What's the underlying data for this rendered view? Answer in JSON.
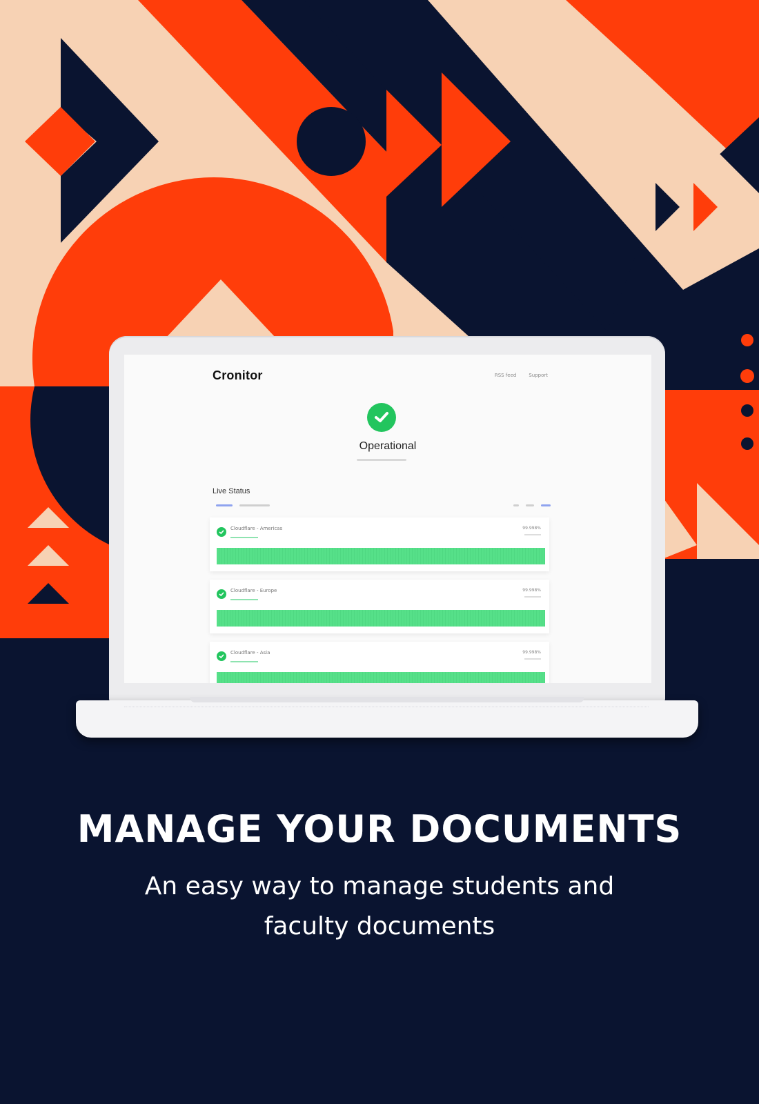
{
  "colors": {
    "navy": "#0a1430",
    "orange": "#ff3d0a",
    "peach": "#f7d2b4",
    "success_green": "#22c55e"
  },
  "screen": {
    "app_name": "Cronitor",
    "nav": [
      "RSS feed",
      "Support"
    ],
    "status": {
      "icon": "check-circle-icon",
      "title": "Operational"
    },
    "live_status_title": "Live Status",
    "monitors": [
      {
        "name": "Cloudflare - Americas",
        "uptime": "99.998%",
        "status_icon": "check-circle-icon"
      },
      {
        "name": "Cloudflare - Europe",
        "uptime": "99.998%",
        "status_icon": "check-circle-icon"
      },
      {
        "name": "Cloudflare - Asia",
        "uptime": "99.998%",
        "status_icon": "check-circle-icon"
      }
    ]
  },
  "headline": "MANAGE YOUR DOCUMENTS",
  "subheadline_line1": "An easy way to manage students and",
  "subheadline_line2": "faculty documents"
}
